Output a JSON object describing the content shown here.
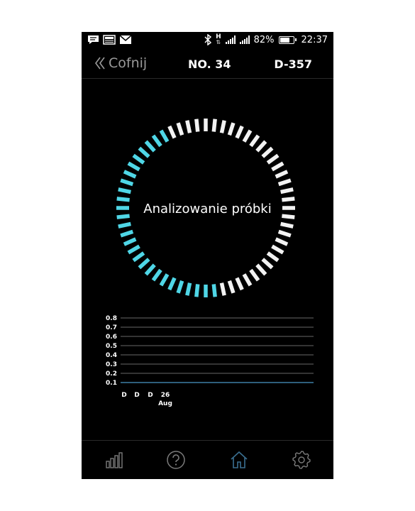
{
  "status_bar": {
    "battery": "82%",
    "battery_level": 0.82,
    "time": "22:37",
    "network_indicator": "H"
  },
  "header": {
    "back_label": "Cofnij",
    "number": "NO. 34",
    "device_id": "D-357"
  },
  "progress": {
    "label": "Analizowanie próbki",
    "active_color": "#4fd6e6",
    "inactive_color": "#f2f2f2",
    "total_segments": 60,
    "start_fraction": 0.48,
    "end_fraction": 0.92
  },
  "chart_data": {
    "type": "line",
    "y_ticks": [
      "0.8",
      "0.7",
      "0.6",
      "0.5",
      "0.4",
      "0.3",
      "0.2",
      "0.1"
    ],
    "ylim": [
      0.1,
      0.8
    ],
    "x": [
      "D",
      "D",
      "D",
      "26"
    ],
    "x_sublabel": "Aug",
    "series": [
      {
        "values": [
          0.1,
          0.1,
          0.1,
          0.1
        ],
        "color": "#3d7fa6"
      }
    ]
  },
  "bottom_nav": {
    "items": [
      {
        "name": "stats",
        "icon": "bar-chart-icon"
      },
      {
        "name": "help",
        "icon": "help-icon"
      },
      {
        "name": "home",
        "icon": "home-icon"
      },
      {
        "name": "settings",
        "icon": "gear-icon"
      }
    ]
  }
}
